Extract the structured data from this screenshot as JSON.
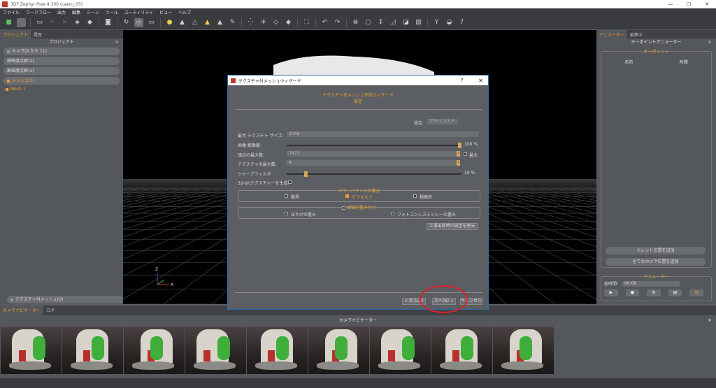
{
  "window": {
    "title": "3DF Zephyr Free 4.300 (caeru_05)",
    "min": "—",
    "max": "□",
    "close": "✕"
  },
  "menu": [
    "ファイル",
    "ワークフロー",
    "出力",
    "編集",
    "シーン",
    "ツール",
    "ユーティリティ",
    "ビュー",
    "ヘルプ"
  ],
  "toolbar_help": "?",
  "left_panel": {
    "tabs": [
      "プロジェクト",
      "履歴"
    ],
    "header": "プロジェクト",
    "close": "×",
    "items": [
      "カメラ(9 から 11)",
      "疎密度点群(1)",
      "高密度点群(1)",
      "メッシュ(1)"
    ],
    "sub_item": "Mesh 1",
    "bottom_item": "テクスチャ付メッシュ(0)"
  },
  "viewport": {
    "axis_z": "Z",
    "axis_x": "X"
  },
  "right_panel": {
    "tabs": [
      "アニメーター",
      "編集中"
    ],
    "header": "キーポイントアニメーター",
    "close": "×",
    "keypoint_title": "キーポイント",
    "col_name": "名前",
    "col_time": "時間",
    "add_current": "カレント位置を追加",
    "add_all": "全てのカメラ位置を追加",
    "animator_title": "アニメーター",
    "total_time_label": "総時間:",
    "total_time_value": "00:00"
  },
  "bottom": {
    "tabs": [
      "カメラナビゲーター",
      "ログ"
    ],
    "header": "カメラナビゲーター",
    "close": "×"
  },
  "dialog": {
    "title": "テクスチャ付メッシュウィザード",
    "help": "?",
    "close": "✕",
    "heading": "テクスチャ付メッシュ作成ウィザード",
    "subheading": "設定",
    "settings_label": "設定:",
    "settings_value": "アドバンスド",
    "max_texture_label": "最大 テクスチャ サイズ:",
    "max_texture_value": "2048",
    "resolution_label": "画像 解像度:",
    "resolution_pct": "100 %",
    "resolution_value": 100,
    "max_vertices_label": "頂点の最大数:",
    "max_vertices_value": "7473",
    "max_label": "最大",
    "max_textures_label": "テクスチャの最大数:",
    "max_textures_value": "4",
    "sharpen_label": "シャープフィルタ",
    "sharpen_pct": "10 %",
    "sharpen_value": 10,
    "bit32_label": "32-bitテクスチャーを生成:",
    "color_balance_title": "カラーバランスの働き",
    "cb_options": [
      "限界",
      "デフォルト",
      "積極的"
    ],
    "blend_title": "実験的重み付け",
    "blend_options": [
      "ぼやけの重み",
      "フォトコンシステンシーの重み"
    ],
    "reset_button": "工場出荷時の設定を復元",
    "back_button": "< 戻る(B)",
    "next_button": "次へ(N) >",
    "cancel_button": "キャンセル"
  },
  "colors": {
    "accent": "#f0a030",
    "annotation": "#e0202a"
  }
}
